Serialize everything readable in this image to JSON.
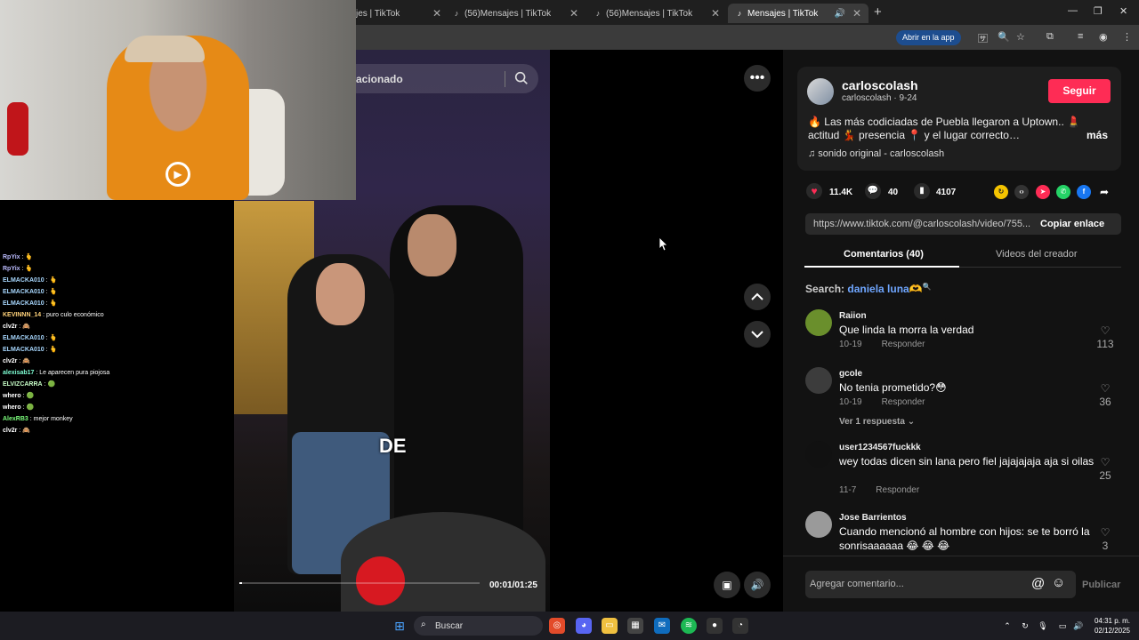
{
  "browser": {
    "tabs": [
      {
        "label": "jes | TikTok"
      },
      {
        "label": "(56)Mensajes | TikTok"
      },
      {
        "label": "(56)Mensajes | TikTok"
      },
      {
        "label": "Mensajes | TikTok"
      }
    ],
    "open_in_app": "Abrir en la app"
  },
  "video": {
    "search_text": "acionado",
    "caption": "DE",
    "time": "00:01/01:25",
    "progress": 0.012
  },
  "creator": {
    "name": "carloscolash",
    "sub": "carloscolash · 9-24",
    "follow": "Seguir",
    "desc_line1": "🔥 Las más codiciadas de Puebla llegaron a Uptown.. 💄",
    "desc_line2": "actitud 💃 presencia 📍 y el lugar correcto…",
    "more": "más",
    "sound": "♫  sonido original - carloscolash"
  },
  "stats": {
    "likes": "11.4K",
    "comments": "40",
    "saves": "4107"
  },
  "link": {
    "url": "https://www.tiktok.com/@carloscolash/video/755...",
    "copy": "Copiar enlace"
  },
  "tabs": {
    "comments": "Comentarios (40)",
    "videos": "Videos del creador"
  },
  "search": {
    "prefix": "Search: ",
    "term": "daniela luna🫶"
  },
  "comments": [
    {
      "user": "Raiion",
      "text": "Que linda la morra la verdad",
      "date": "10-19",
      "reply": "Responder",
      "likes": "113",
      "color": "#6a8f2c"
    },
    {
      "user": "gcole",
      "text": "No tenia prometido?😳",
      "date": "10-19",
      "reply": "Responder",
      "likes": "36",
      "color": "#3c3c3c",
      "more": "Ver 1 respuesta ⌄"
    },
    {
      "user": "user1234567fuckkk",
      "text": "wey todas dicen sin lana pero fiel jajajajaja aja si oilas",
      "date": "11-7",
      "reply": "Responder",
      "likes": "25",
      "color": "#111111"
    },
    {
      "user": "Jose Barrientos",
      "text": "Cuando mencionó al hombre con hijos: se te borró la sonrisaaaaaa 😂 😂 😂",
      "date": "",
      "reply": "",
      "likes": "3",
      "color": "#9a9a9a"
    }
  ],
  "comment_bar": {
    "placeholder": "Agregar comentario...",
    "publish": "Publicar"
  },
  "chat": [
    {
      "user": "RpYix",
      "msg": "🫰",
      "color": "#bcbcff"
    },
    {
      "user": "RpYix",
      "msg": "🫰",
      "color": "#bcbcff"
    },
    {
      "user": "ELMACKA010",
      "msg": "🫰",
      "color": "#a8d8ff"
    },
    {
      "user": "ELMACKA010",
      "msg": "🫰",
      "color": "#a8d8ff"
    },
    {
      "user": "ELMACKA010",
      "msg": "🫰",
      "color": "#a8d8ff"
    },
    {
      "user": "KEVINNN_14",
      "msg": "puro culo económico",
      "color": "#ffd27a"
    },
    {
      "user": "clv2r",
      "msg": "🙈",
      "color": "#ffffff"
    },
    {
      "user": "ELMACKA010",
      "msg": "🫰",
      "color": "#a8d8ff"
    },
    {
      "user": "ELMACKA010",
      "msg": "🫰",
      "color": "#a8d8ff"
    },
    {
      "user": "clv2r",
      "msg": "🙈",
      "color": "#ffffff"
    },
    {
      "user": "alexisab17",
      "msg": "Le aparecen pura piojosa",
      "color": "#7fffd4"
    },
    {
      "user": "ELVIZCARRA",
      "msg": "🟢",
      "color": "#c8ffc8"
    },
    {
      "user": "whero",
      "msg": "🟢",
      "color": "#ffffff"
    },
    {
      "user": "whero",
      "msg": "🟢",
      "color": "#ffffff"
    },
    {
      "user": "AlexRB3",
      "msg": "mejor monkey",
      "color": "#7dff7d"
    },
    {
      "user": "clv2r",
      "msg": "🙈",
      "color": "#ffffff"
    }
  ],
  "taskbar": {
    "search": "Buscar",
    "time": "04:31 p. m.",
    "date": "02/12/2025"
  },
  "colors": {
    "accent": "#fe2c55",
    "link": "#6fa6ff",
    "bg": "#121212"
  }
}
